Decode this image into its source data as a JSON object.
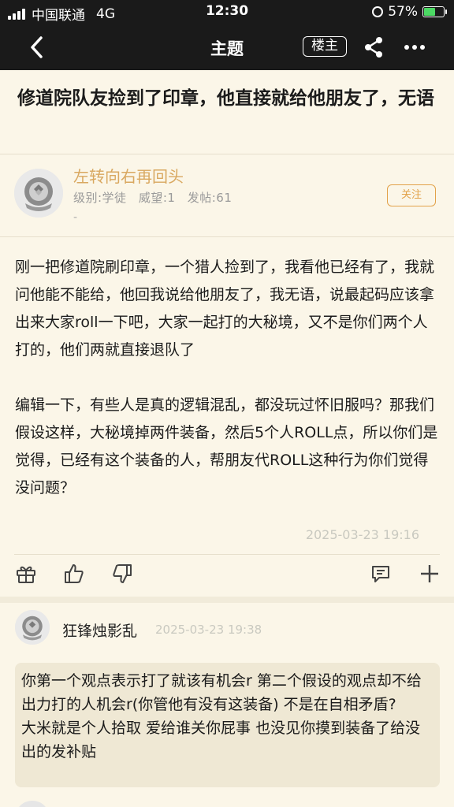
{
  "status_bar": {
    "carrier": "中国联通",
    "network": "4G",
    "time": "12:30",
    "battery": "57%",
    "battery_level": 0.57
  },
  "nav": {
    "title": "主题",
    "owner_label": "楼主",
    "icons": [
      "back-icon",
      "share-icon",
      "more-icon"
    ]
  },
  "post": {
    "title": "修道院队友捡到了印章，他直接就给他朋友了，无语",
    "author": {
      "name": "左转向右再回头",
      "level": "级别:学徒",
      "reputation": "威望:1",
      "posts": "发帖:61",
      "extra": "-",
      "follow_label": "关注"
    },
    "paragraphs": [
      "刚一把修道院刷印章，一个猎人捡到了，我看他已经有了，我就问他能不能给，他回我说给他朋友了，我无语，说最起码应该拿出来大家roll一下吧，大家一起打的大秘境，又不是你们两个人打的，他们两就直接退队了",
      "编辑一下，有些人是真的逻辑混乱，都没玩过怀旧服吗？那我们假设这样，大秘境掉两件装备，然后5个人ROLL点，所以你们是觉得，已经有这个装备的人，帮朋友代ROLL这种行为你们觉得没问题？"
    ],
    "time": "2025-03-23 19:16",
    "action_icons": [
      "gift-icon",
      "like-icon",
      "dislike-icon",
      "comment-icon",
      "add-icon"
    ]
  },
  "reply": {
    "name": "狂锋烛影乱",
    "time": "2025-03-23 19:38",
    "text_line1": "你第一个观点表示打了就该有机会r 第二个假设的观点却不给出力打的人机会r(你管他有没有这装备) 不是在自相矛盾?",
    "text_line2": "大米就是个人拾取 爱给谁关你屁事 也没见你摸到装备了给没出的发补贴"
  },
  "colors": {
    "background": "#fbf6e8",
    "accent": "#e2a24a",
    "author_name": "#d9a860",
    "topbar": "#1a1a1a"
  }
}
